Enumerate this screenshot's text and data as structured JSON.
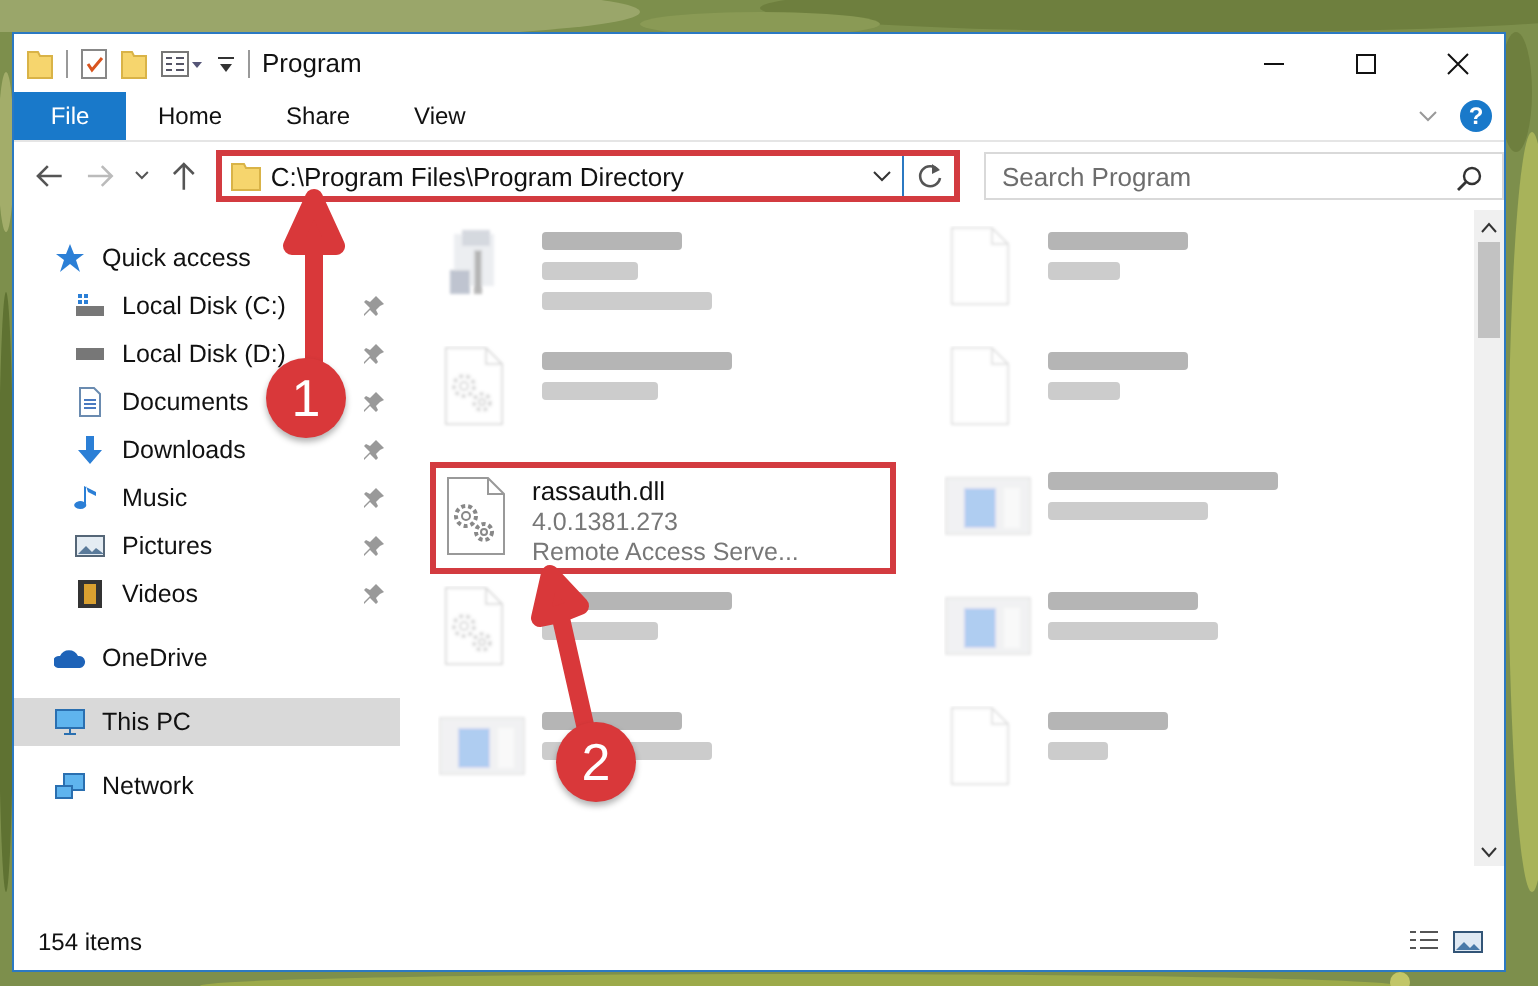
{
  "window": {
    "title": "Program"
  },
  "ribbon": {
    "tabs": [
      {
        "label": "File",
        "kind": "menu",
        "selected": false
      },
      {
        "label": "Home",
        "kind": "tab",
        "selected": false
      },
      {
        "label": "Share",
        "kind": "tab",
        "selected": false
      },
      {
        "label": "View",
        "kind": "tab",
        "selected": false
      }
    ],
    "help_button": "?"
  },
  "address_bar": {
    "path": "C:\\Program Files\\Program Directory",
    "highlighted": true
  },
  "search": {
    "placeholder": "Search Program"
  },
  "sidebar": {
    "items": [
      {
        "label": "Quick access",
        "selected": false,
        "children": [
          {
            "label": "Local Disk (C:)",
            "pinned": true,
            "selected": false
          },
          {
            "label": "Local Disk (D:)",
            "pinned": true,
            "selected": false
          },
          {
            "label": "Documents",
            "pinned": true,
            "selected": false
          },
          {
            "label": "Downloads",
            "pinned": true,
            "selected": false
          },
          {
            "label": "Music",
            "pinned": true,
            "selected": false
          },
          {
            "label": "Pictures",
            "pinned": true,
            "selected": false
          },
          {
            "label": "Videos",
            "pinned": true,
            "selected": false
          }
        ]
      },
      {
        "label": "OneDrive",
        "selected": false
      },
      {
        "label": "This PC",
        "selected": true
      },
      {
        "label": "Network",
        "selected": false
      }
    ]
  },
  "files": [
    {
      "kind": "blurred"
    },
    {
      "kind": "blurred"
    },
    {
      "kind": "blurred"
    },
    {
      "kind": "blurred"
    },
    {
      "kind": "file",
      "name": "rassauth.dll",
      "version": "4.0.1381.273",
      "description": "Remote Access Serve...",
      "highlighted": true
    },
    {
      "kind": "blurred"
    },
    {
      "kind": "blurred"
    },
    {
      "kind": "blurred"
    },
    {
      "kind": "blurred"
    },
    {
      "kind": "blurred"
    }
  ],
  "status_bar": {
    "count": "154 items"
  },
  "annotations": [
    {
      "label": "1"
    },
    {
      "label": "2"
    }
  ]
}
